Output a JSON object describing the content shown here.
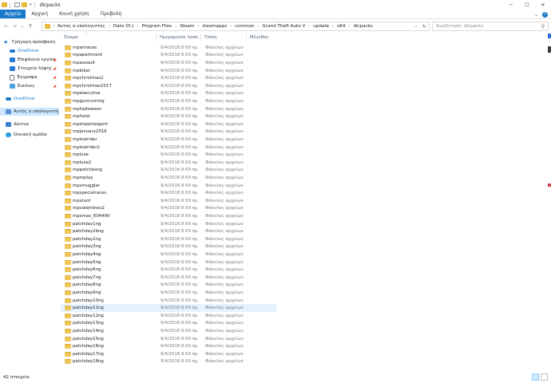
{
  "window": {
    "title": "dlcpacks"
  },
  "ribbon": {
    "tabs": [
      "Αρχείο",
      "Αρχική",
      "Κοινή χρήση",
      "Προβολή"
    ]
  },
  "address": {
    "crumbs": [
      "Αυτός ο υπολογιστής",
      "Data (D:)",
      "Program Files",
      "Steam",
      "steamapps",
      "common",
      "Grand Theft Auto V",
      "update",
      "x64",
      "dlcpacks"
    ]
  },
  "search": {
    "placeholder": "Αναζήτηση: dlcpacks"
  },
  "nav": {
    "items": [
      {
        "label": "Γρήγορη πρόσβαση",
        "icon": "star-icon"
      },
      {
        "label": "OneDrive",
        "icon": "cloud-icon"
      },
      {
        "label": "Επιφάνεια εργασ",
        "icon": "desktop-icon"
      },
      {
        "label": "Στοιχεία λήψης",
        "icon": "download-icon"
      },
      {
        "label": "Έγγραφα",
        "icon": "document-icon"
      },
      {
        "label": "Εικόνες",
        "icon": "pictures-icon"
      },
      {
        "label": "OneDrive",
        "icon": "cloud-icon"
      },
      {
        "label": "Αυτός ο υπολογιστή",
        "icon": "computer-icon"
      },
      {
        "label": "Δίκτυο",
        "icon": "network-icon"
      },
      {
        "label": "Οικιακή ομάδα",
        "icon": "homegroup-icon"
      }
    ]
  },
  "columns": {
    "name": "Όνομα",
    "date": "Ημερομηνία τροπ...",
    "type": "Τύπος",
    "size": "Μέγεθος"
  },
  "files": {
    "date": "9/4/2018 8:59 πμ",
    "type": "Φάκελος αρχείων",
    "names": [
      "mpairraces",
      "mpapartment",
      "mpassault",
      "mpbiker",
      "mpchristmas2",
      "mpchristmas2017",
      "mpexecutive",
      "mpgunrunning",
      "mphalloween",
      "mpheist",
      "mpimportexport",
      "mpjanuary2016",
      "mplowrider",
      "mplowrider2",
      "mpluxe",
      "mpluxe2",
      "mppatchesng",
      "mpreplay",
      "mpsmuggler",
      "mpspecialraces",
      "mpstunt",
      "mpvalentines2",
      "mpxmas_604490",
      "patchday1ng",
      "patchday2bng",
      "patchday2ng",
      "patchday3ng",
      "patchday4ng",
      "patchday5ng",
      "patchday6ng",
      "patchday7ng",
      "patchday8ng",
      "patchday9ng",
      "patchday10ng",
      "patchday11ng",
      "patchday12ng",
      "patchday13ng",
      "patchday14ng",
      "patchday15ng",
      "patchday16ng",
      "patchday17ng",
      "patchday18ng"
    ],
    "highlighted_index": 34
  },
  "status": {
    "count": "42 στοιχεία"
  },
  "colors": {
    "accent": "#1979ca",
    "selection": "#cce8ff",
    "hover": "#e5f3ff",
    "folder": "#efc65a"
  }
}
